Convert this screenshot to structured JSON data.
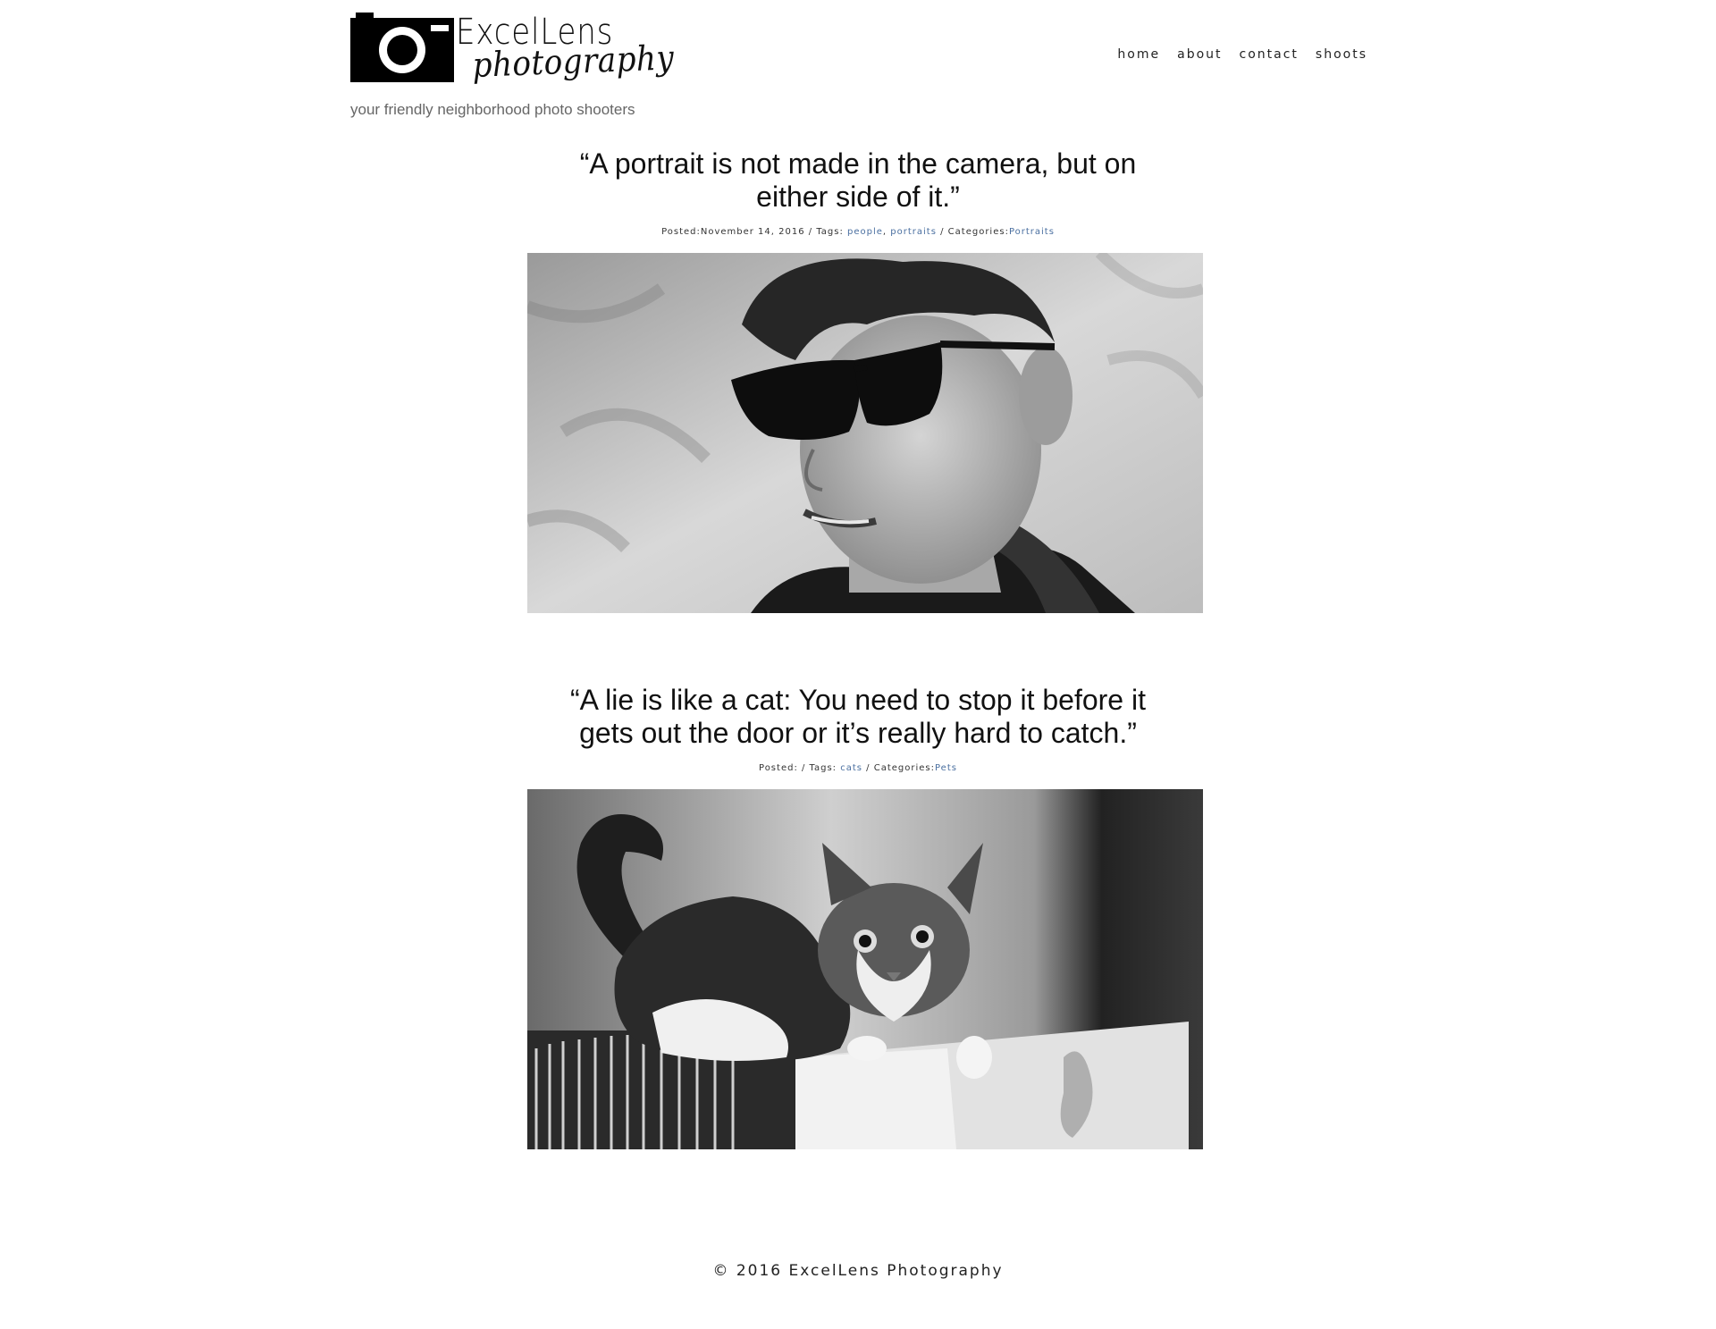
{
  "header": {
    "logo": {
      "word": "ExcelLens",
      "script": "photography"
    },
    "tagline": "your friendly neighborhood photo shooters",
    "nav": [
      "home",
      "about",
      "contact",
      "shoots"
    ]
  },
  "posts": [
    {
      "title": "“A portrait is not made in the camera, but on either side of it.”",
      "posted_label": "Posted:",
      "date": "November 14, 2016",
      "tags_label": " / Tags: ",
      "tags": [
        "people",
        "portraits"
      ],
      "categories_label": " / Categories:",
      "category": "Portraits",
      "image_icon": "portrait-photo"
    },
    {
      "title": "“A lie is like a cat: You need to stop it before it gets out the door or it’s really hard to catch.”",
      "posted_label": "Posted: ",
      "date": "",
      "tags_label": "/ Tags: ",
      "tags": [
        "cats"
      ],
      "categories_label": " / Categories:",
      "category": "Pets",
      "image_icon": "kitten-photo"
    }
  ],
  "footer": {
    "copyright": "© 2016 ExcelLens Photography"
  },
  "colors": {
    "link": "#4a6fa0",
    "text": "#111111",
    "tagline": "#666666"
  }
}
